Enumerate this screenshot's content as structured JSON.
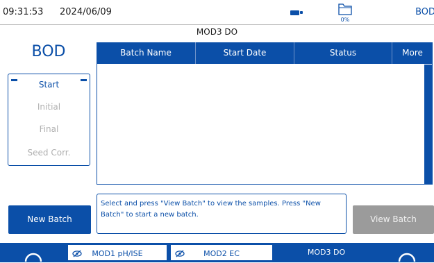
{
  "status_bar": {
    "time": "09:31:53",
    "date": "2024/06/09",
    "storage": "0%",
    "app_short": "BOD"
  },
  "module_title": "MOD3 DO",
  "method": "BOD",
  "steps": [
    {
      "label": "Start",
      "active": true
    },
    {
      "label": "Initial",
      "active": false
    },
    {
      "label": "Final",
      "active": false
    },
    {
      "label": "Seed Corr.",
      "active": false
    }
  ],
  "table": {
    "columns": [
      "Batch Name",
      "Start Date",
      "Status",
      "More"
    ],
    "rows": []
  },
  "message": "Select and press \"View Batch\" to view the samples. Press \"New Batch\" to start a new batch.",
  "buttons": {
    "new_batch": "New Batch",
    "view_batch": "View Batch"
  },
  "bottom_tabs": [
    {
      "label": "MOD1 pH/ISE",
      "active": false
    },
    {
      "label": "MOD2 EC",
      "active": false
    },
    {
      "label": "MOD3 DO",
      "active": true
    }
  ],
  "colors": {
    "accent": "#0b4fa8",
    "disabled": "#9b9b9b",
    "inactive_text": "#b0b0b0"
  }
}
